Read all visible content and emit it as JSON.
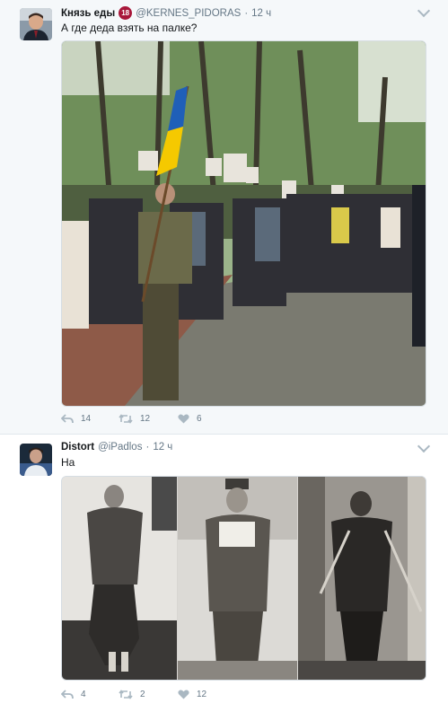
{
  "tweets": [
    {
      "name": "Князь еды",
      "badge": "18",
      "handle": "@KERNES_PIDORAS",
      "time": "12 ч",
      "text": "А где деда взять на палке?",
      "replies": "14",
      "retweets": "12",
      "likes": "6"
    },
    {
      "name": "Distort",
      "handle": "@iPadlos",
      "time": "12 ч",
      "text": "На",
      "replies": "4",
      "retweets": "2",
      "likes": "12"
    }
  ],
  "separator_dot": "·",
  "icons": [
    "reply-icon",
    "retweet-icon",
    "like-icon",
    "chevron-down-icon"
  ],
  "colors": {
    "thread_line": "#a3d3ee",
    "badge": "#a8173a",
    "muted": "#657786",
    "flag_blue": "#1f5fb8",
    "flag_yellow": "#f5c900"
  }
}
